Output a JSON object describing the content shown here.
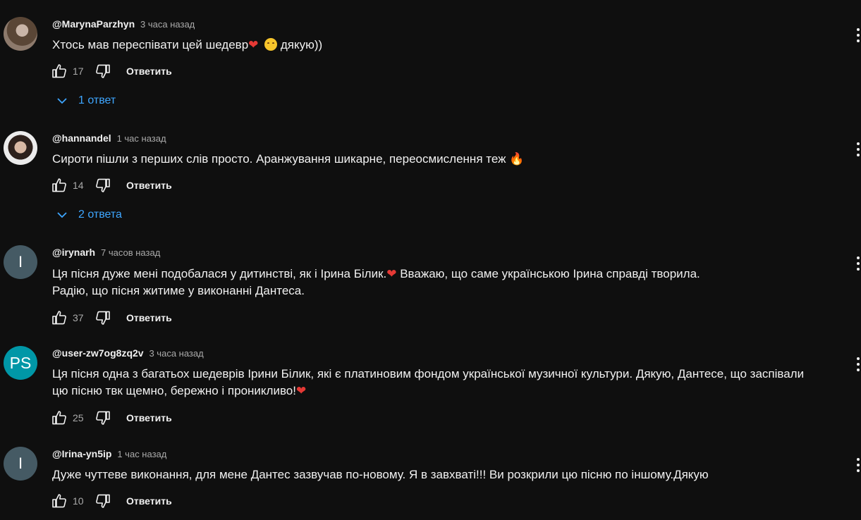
{
  "comments": [
    {
      "author": "@MarynaParzhyn",
      "time": "3 часа назад",
      "lines": [
        "Хтось мав переспівати цей шедевр❤️ 😊  дякую))"
      ],
      "likes": "17",
      "reply_label": "Ответить",
      "replies_label": "1 ответ"
    },
    {
      "author": "@hannandel",
      "time": "1 час назад",
      "lines": [
        "Сироти пішли з перших слів просто. Аранжування шикарне, переосмислення теж 🔥"
      ],
      "likes": "14",
      "reply_label": "Ответить",
      "replies_label": "2 ответа"
    },
    {
      "author": "@irynarh",
      "time": "7 часов назад",
      "avatar_letter": "I",
      "lines": [
        "Ця пісня дуже мені подобалася у дитинстві, як і Ірина Білик.❤️  Вважаю, що саме українською Ірина справді творила.",
        "Радію, що пісня житиме у виконанні Дантеса."
      ],
      "likes": "37",
      "reply_label": "Ответить"
    },
    {
      "author": "@user-zw7og8zq2v",
      "time": "3 часа назад",
      "avatar_letter": "PS",
      "lines": [
        "Ця пісня одна з багатьох шедеврів Ірини Білик, які є платиновим фондом української музичної культури. Дякую, Дантесе, що заспівали",
        "цю пісню твк щемно, бережно і проникливо!❤️"
      ],
      "likes": "25",
      "reply_label": "Ответить"
    },
    {
      "author": "@Irina-yn5ip",
      "time": "1 час назад",
      "avatar_letter": "I",
      "lines": [
        "Дуже чуттеве виконання, для  мене Дантес зазвучав по-новому. Я в завхваті!!! Ви розкрили цю пісню по іншому.Дякую"
      ],
      "likes": "10",
      "reply_label": "Ответить"
    }
  ],
  "colors": {
    "background": "#0f0f0f",
    "text": "#f1f1f1",
    "secondary": "#aaaaaa",
    "link": "#3ea6ff",
    "avatar_i": "#455a64",
    "avatar_ps": "#0097a7"
  },
  "icons": [
    "thumb-up-icon",
    "thumb-down-icon",
    "chevron-down-icon",
    "more-vert-icon"
  ]
}
